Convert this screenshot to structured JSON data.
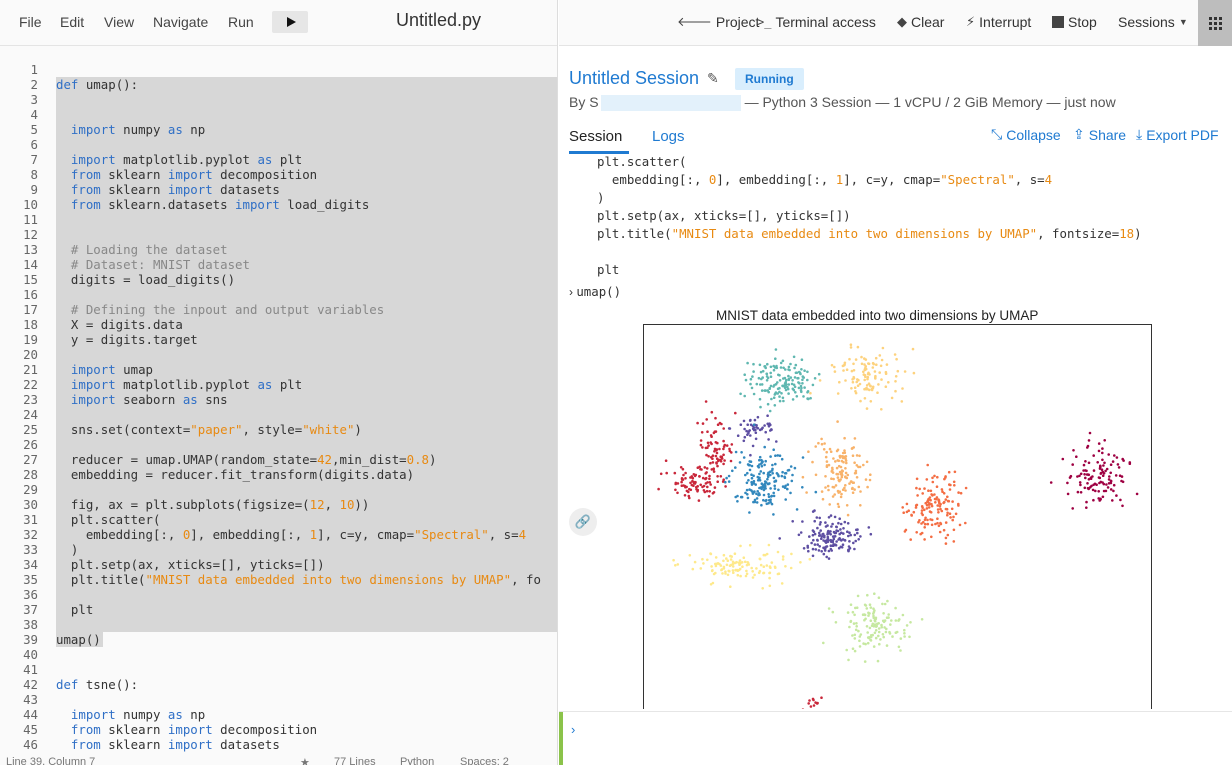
{
  "menubar": {
    "items": [
      "File",
      "Edit",
      "View",
      "Navigate",
      "Run"
    ],
    "file_title": "Untitled.py"
  },
  "editor": {
    "lines": [
      "",
      "def umap():",
      "",
      "",
      "  import numpy as np",
      "",
      "  import matplotlib.pyplot as plt",
      "  from sklearn import decomposition",
      "  from sklearn import datasets",
      "  from sklearn.datasets import load_digits",
      "",
      "",
      "  # Loading the dataset",
      "  # Dataset: MNIST dataset",
      "  digits = load_digits()",
      "",
      "  # Defining the inpout and output variables",
      "  X = digits.data",
      "  y = digits.target",
      "",
      "  import umap",
      "  import matplotlib.pyplot as plt",
      "  import seaborn as sns",
      "",
      "  sns.set(context=\"paper\", style=\"white\")",
      "",
      "  reducer = umap.UMAP(random_state=42,min_dist=0.8)",
      "  embedding = reducer.fit_transform(digits.data)",
      "",
      "  fig, ax = plt.subplots(figsize=(12, 10))",
      "  plt.scatter(",
      "    embedding[:, 0], embedding[:, 1], c=y, cmap=\"Spectral\", s=4",
      "  )",
      "  plt.setp(ax, xticks=[], yticks=[])",
      "  plt.title(\"MNIST data embedded into two dimensions by UMAP\", fo",
      "",
      "  plt",
      "",
      "umap()",
      "",
      "",
      "def tsne():",
      "",
      "  import numpy as np",
      "  from sklearn import decomposition",
      "  from sklearn import datasets"
    ]
  },
  "statusbar": {
    "position": "Line 39, Column 7",
    "star": "★",
    "lines": "77 Lines",
    "language": "Python",
    "spaces": "Spaces: 2"
  },
  "topbar": {
    "project": "Project",
    "terminal": "Terminal access",
    "clear": "Clear",
    "interrupt": "Interrupt",
    "stop": "Stop",
    "sessions": "Sessions"
  },
  "session": {
    "title": "Untitled Session",
    "status": "Running",
    "by_prefix": "By",
    "by_initial": "S",
    "by_suffix": "— Python 3 Session — 1 vCPU / 2 GiB Memory — just now",
    "tabs": [
      "Session",
      "Logs"
    ],
    "actions": [
      "Collapse",
      "Share",
      "Export PDF"
    ]
  },
  "output": {
    "code": [
      "plt.scatter(",
      "  embedding[:, 0], embedding[:, 1], c=y, cmap=\"Spectral\", s=4",
      ")",
      "plt.setp(ax, xticks=[], yticks=[])",
      "plt.title(\"MNIST data embedded into two dimensions by UMAP\", fontsize=18)",
      "",
      "plt"
    ],
    "prompt_symbol": "›",
    "prompt_code": "umap()"
  },
  "chart_data": {
    "type": "scatter",
    "title": "MNIST data embedded into two dimensions by UMAP",
    "xlabel": "",
    "ylabel": "",
    "xticks": [],
    "yticks": [],
    "grid": false,
    "clusters": [
      {
        "color": "#5fb7b0",
        "center": [
          0.27,
          0.14
        ],
        "spread": [
          0.07,
          0.06
        ],
        "count": 150
      },
      {
        "color": "#fdd27e",
        "center": [
          0.44,
          0.13
        ],
        "spread": [
          0.065,
          0.07
        ],
        "count": 110
      },
      {
        "color": "#c9273a",
        "center": [
          0.14,
          0.31
        ],
        "spread": [
          0.035,
          0.07
        ],
        "count": 80
      },
      {
        "color": "#5e4fa2",
        "center": [
          0.22,
          0.26
        ],
        "spread": [
          0.05,
          0.04
        ],
        "count": 50
      },
      {
        "color": "#c9273a",
        "center": [
          0.1,
          0.39
        ],
        "spread": [
          0.05,
          0.04
        ],
        "count": 80
      },
      {
        "color": "#3288bd",
        "center": [
          0.235,
          0.39
        ],
        "spread": [
          0.065,
          0.07
        ],
        "count": 170
      },
      {
        "color": "#f8b26a",
        "center": [
          0.385,
          0.37
        ],
        "spread": [
          0.05,
          0.09
        ],
        "count": 130
      },
      {
        "color": "#f46d43",
        "center": [
          0.57,
          0.45
        ],
        "spread": [
          0.055,
          0.09
        ],
        "count": 140
      },
      {
        "color": "#9e0142",
        "center": [
          0.89,
          0.38
        ],
        "spread": [
          0.06,
          0.07
        ],
        "count": 120
      },
      {
        "color": "#5e4fa2",
        "center": [
          0.37,
          0.53
        ],
        "spread": [
          0.055,
          0.045
        ],
        "count": 150
      },
      {
        "color": "#fee98b",
        "center": [
          0.19,
          0.6
        ],
        "spread": [
          0.1,
          0.04
        ],
        "count": 120
      },
      {
        "color": "#c6e8a0",
        "center": [
          0.45,
          0.75
        ],
        "spread": [
          0.065,
          0.07
        ],
        "count": 130
      },
      {
        "color": "#c9273a",
        "center": [
          0.33,
          0.95
        ],
        "spread": [
          0.02,
          0.02
        ],
        "count": 14
      }
    ]
  },
  "input": {
    "prompt_symbol": "›"
  }
}
